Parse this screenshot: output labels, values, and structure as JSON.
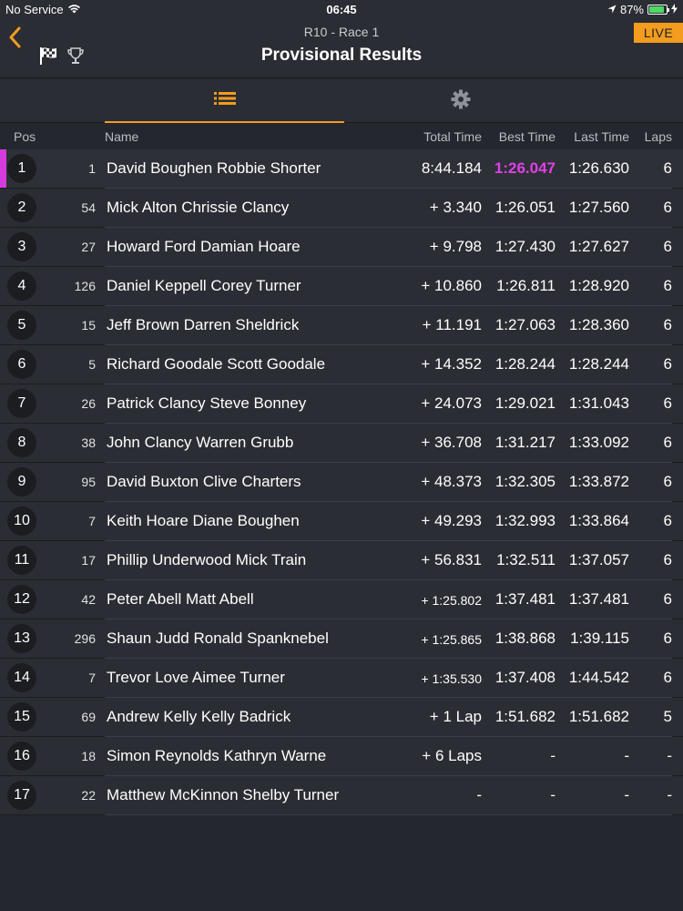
{
  "status_bar": {
    "carrier": "No Service",
    "time": "06:45",
    "battery": "87%",
    "battery_level": 0.87
  },
  "header": {
    "subtitle": "R10 - Race 1",
    "title": "Provisional Results",
    "live_label": "LIVE"
  },
  "colors": {
    "accent": "#f39c1e",
    "fastest": "#e040e8",
    "background": "#24272d"
  },
  "columns": {
    "pos": "Pos",
    "name": "Name",
    "total": "Total Time",
    "best": "Best Time",
    "last": "Last Time",
    "laps": "Laps"
  },
  "rows": [
    {
      "pos": "1",
      "num": "1",
      "name": "David Boughen Robbie Shorter",
      "total": "8:44.184",
      "best": "1:26.047",
      "last": "1:26.630",
      "laps": "6"
    },
    {
      "pos": "2",
      "num": "54",
      "name": "Mick Alton Chrissie Clancy",
      "total": "+ 3.340",
      "best": "1:26.051",
      "last": "1:27.560",
      "laps": "6"
    },
    {
      "pos": "3",
      "num": "27",
      "name": "Howard Ford Damian Hoare",
      "total": "+ 9.798",
      "best": "1:27.430",
      "last": "1:27.627",
      "laps": "6"
    },
    {
      "pos": "4",
      "num": "126",
      "name": "Daniel Keppell Corey Turner",
      "total": "+ 10.860",
      "best": "1:26.811",
      "last": "1:28.920",
      "laps": "6"
    },
    {
      "pos": "5",
      "num": "15",
      "name": "Jeff Brown Darren Sheldrick",
      "total": "+ 11.191",
      "best": "1:27.063",
      "last": "1:28.360",
      "laps": "6"
    },
    {
      "pos": "6",
      "num": "5",
      "name": "Richard Goodale Scott Goodale",
      "total": "+ 14.352",
      "best": "1:28.244",
      "last": "1:28.244",
      "laps": "6"
    },
    {
      "pos": "7",
      "num": "26",
      "name": "Patrick Clancy Steve Bonney",
      "total": "+ 24.073",
      "best": "1:29.021",
      "last": "1:31.043",
      "laps": "6"
    },
    {
      "pos": "8",
      "num": "38",
      "name": "John Clancy Warren Grubb",
      "total": "+ 36.708",
      "best": "1:31.217",
      "last": "1:33.092",
      "laps": "6"
    },
    {
      "pos": "9",
      "num": "95",
      "name": "David Buxton Clive Charters",
      "total": "+ 48.373",
      "best": "1:32.305",
      "last": "1:33.872",
      "laps": "6"
    },
    {
      "pos": "10",
      "num": "7",
      "name": "Keith Hoare Diane Boughen",
      "total": "+ 49.293",
      "best": "1:32.993",
      "last": "1:33.864",
      "laps": "6"
    },
    {
      "pos": "11",
      "num": "17",
      "name": "Phillip Underwood Mick Train",
      "total": "+ 56.831",
      "best": "1:32.511",
      "last": "1:37.057",
      "laps": "6"
    },
    {
      "pos": "12",
      "num": "42",
      "name": "Peter Abell Matt Abell",
      "total": "+ 1:25.802",
      "best": "1:37.481",
      "last": "1:37.481",
      "laps": "6"
    },
    {
      "pos": "13",
      "num": "296",
      "name": "Shaun Judd Ronald Spanknebel",
      "total": "+ 1:25.865",
      "best": "1:38.868",
      "last": "1:39.115",
      "laps": "6"
    },
    {
      "pos": "14",
      "num": "7",
      "name": "Trevor Love Aimee Turner",
      "total": "+ 1:35.530",
      "best": "1:37.408",
      "last": "1:44.542",
      "laps": "6"
    },
    {
      "pos": "15",
      "num": "69",
      "name": "Andrew Kelly Kelly Badrick",
      "total": "+ 1 Lap",
      "best": "1:51.682",
      "last": "1:51.682",
      "laps": "5"
    },
    {
      "pos": "16",
      "num": "18",
      "name": "Simon Reynolds Kathryn Warne",
      "total": "+ 6 Laps",
      "best": "-",
      "last": "-",
      "laps": "-"
    },
    {
      "pos": "17",
      "num": "22",
      "name": "Matthew McKinnon Shelby Turner",
      "total": "-",
      "best": "-",
      "last": "-",
      "laps": "-"
    }
  ]
}
